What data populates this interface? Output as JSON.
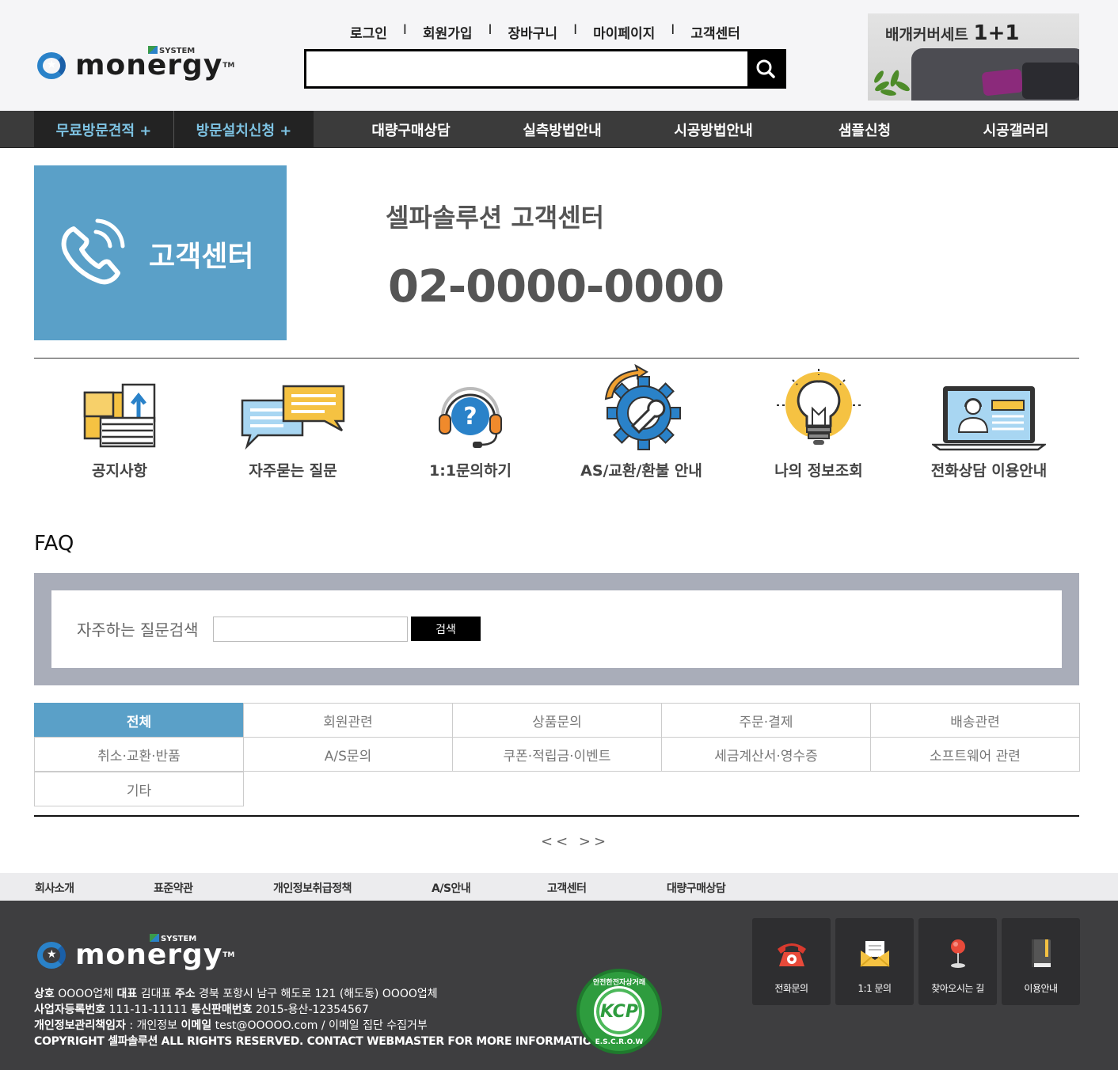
{
  "header": {
    "logo": {
      "word": "monergy",
      "tm": "TM",
      "system": "SYSTEM"
    },
    "top_links": [
      "로그인",
      "회원가입",
      "장바구니",
      "마이페이지",
      "고객센터"
    ],
    "separator": "I",
    "search": {
      "placeholder": "",
      "button_icon": "search-icon"
    },
    "banner": {
      "text": "배개커버세트",
      "highlight": "1+1"
    }
  },
  "main_nav": [
    "무료방문견적 +",
    "방문설치신청 +",
    "대량구매상담",
    "실측방법안내",
    "시공방법안내",
    "샘플신청",
    "시공갤러리"
  ],
  "customer_center": {
    "box_label": "고객센터",
    "title": "셀파솔루션 고객센터",
    "phone": "02-0000-0000"
  },
  "quick_menu": [
    {
      "label": "공지사항",
      "icon": "notice-box-icon"
    },
    {
      "label": "자주묻는 질문",
      "icon": "chat-bubbles-icon"
    },
    {
      "label": "1:1문의하기",
      "icon": "headset-question-icon"
    },
    {
      "label": "AS/교환/환불 안내",
      "icon": "gear-wrench-icon"
    },
    {
      "label": "나의 정보조회",
      "icon": "lightbulb-icon"
    },
    {
      "label": "전화상담 이용안내",
      "icon": "laptop-agent-icon"
    }
  ],
  "faq": {
    "title": "FAQ",
    "search_label": "자주하는 질문검색",
    "search_value": "",
    "search_button": "검색",
    "categories": [
      "전체",
      "회원관련",
      "상품문의",
      "주문·결제",
      "배송관련",
      "취소·교환·반품",
      "A/S문의",
      "쿠폰·적립금·이벤트",
      "세금계산서·영수증",
      "소프트웨어 관련",
      "기타"
    ],
    "active_category": "전체",
    "pager": "<< >>"
  },
  "footer": {
    "links": [
      "회사소개",
      "표준약관",
      "개인정보취급정책",
      "A/S안내",
      "고객센터",
      "대량구매상담"
    ],
    "info": {
      "line1_label1": "상호",
      "line1_val1": "OOOO업체",
      "line1_label2": "대표",
      "line1_val2": "김대표",
      "line1_label3": "주소",
      "line1_val3": "경북 포항시 남구 해도로 121 (해도동) OOOO업체",
      "line2_label1": "사업자등록번호",
      "line2_val1": "111-11-11111",
      "line2_label2": "통신판매번호",
      "line2_val2": "2015-용산-12354567",
      "line3_label1": "개인정보관리책임자",
      "line3_val1": ": 개인정보",
      "line3_label2": "이메일",
      "line3_val2": "test@OOOOO.com / 이메일 집단 수집거부",
      "copyright": "COPYRIGHT 셀파솔루션 ALL RIGHTS RESERVED. CONTACT WEBMASTER FOR MORE INFORMATION."
    },
    "kcp": {
      "text": "KCP",
      "ring_top": "안전한전자상거래",
      "ring_bottom": "E.S.C.R.O.W"
    },
    "quick_links": [
      {
        "label": "전화문의",
        "icon": "telephone-icon"
      },
      {
        "label": "1:1 문의",
        "icon": "envelope-icon"
      },
      {
        "label": "찾아오시는 길",
        "icon": "map-pin-icon"
      },
      {
        "label": "이용안내",
        "icon": "book-icon"
      }
    ]
  },
  "colors": {
    "accent_blue": "#5aa0c8",
    "nav_bg": "#3b3b3b",
    "footer_bg": "#3e3e40",
    "faq_frame": "#a9adb9"
  }
}
